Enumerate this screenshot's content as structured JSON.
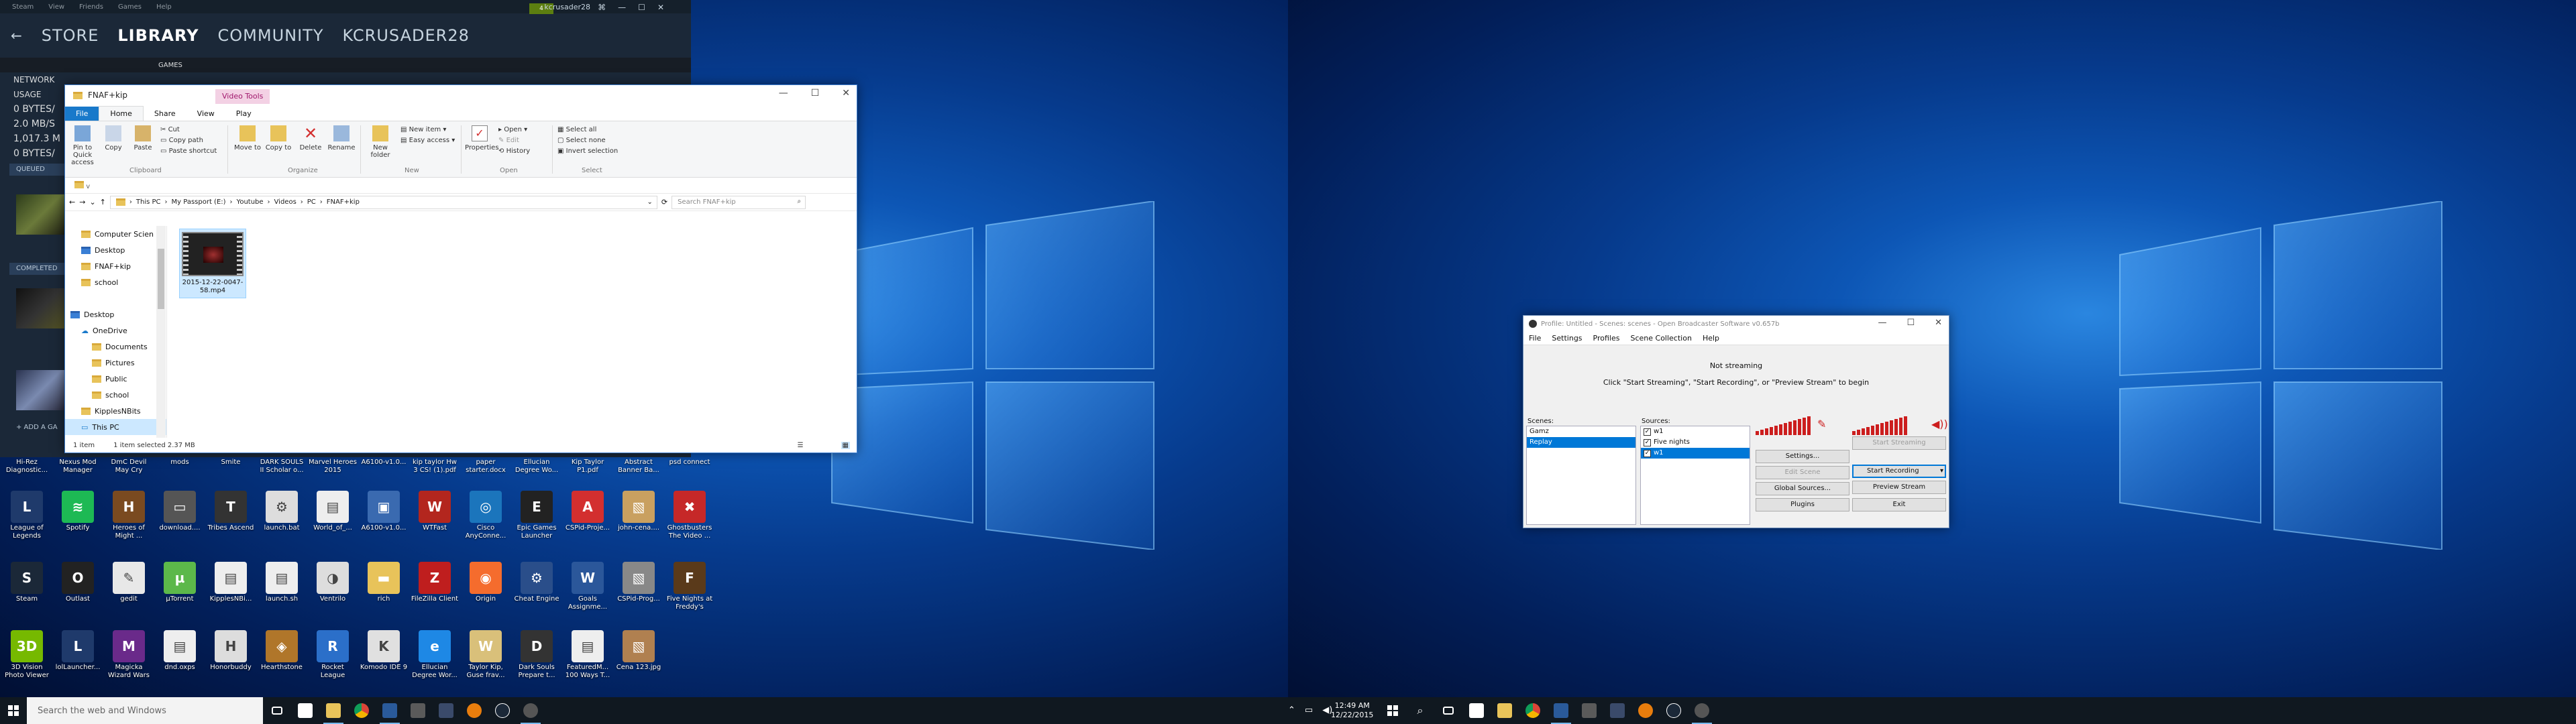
{
  "steam": {
    "menu": [
      "Steam",
      "View",
      "Friends",
      "Games",
      "Help"
    ],
    "nav": [
      "STORE",
      "LIBRARY",
      "COMMUNITY",
      "KCRUSADER28"
    ],
    "active_nav": "LIBRARY",
    "sub_tab": "GAMES",
    "username": "kcrusader28",
    "badge": "4",
    "network_label": "NETWORK USAGE",
    "network_stats": [
      "0 BYTES/",
      "2.0 MB/S",
      "1,017.3 M",
      "0 BYTES/"
    ],
    "queued_label": "QUEUED",
    "completed_label": "COMPLETED",
    "add_game": "+ ADD A GA"
  },
  "explorer": {
    "title": "FNAF+kip",
    "tools_tab": "Video Tools",
    "tabs": [
      "File",
      "Home",
      "Share",
      "View",
      "Play"
    ],
    "ribbon": {
      "pin": "Pin to Quick access",
      "copy": "Copy",
      "paste": "Paste",
      "cut": "Cut",
      "copy_path": "Copy path",
      "paste_shortcut": "Paste shortcut",
      "move_to": "Move to",
      "copy_to": "Copy to",
      "delete": "Delete",
      "rename": "Rename",
      "new_folder": "New folder",
      "new_item": "New item",
      "easy_access": "Easy access",
      "properties": "Properties",
      "open": "Open",
      "edit": "Edit",
      "history": "History",
      "select_all": "Select all",
      "select_none": "Select none",
      "invert_selection": "Invert selection",
      "groups": [
        "Clipboard",
        "Organize",
        "New",
        "Open",
        "Select"
      ]
    },
    "quick_access_bar": "v",
    "path": [
      "This PC",
      "My Passport (E:)",
      "Youtube",
      "Videos",
      "PC",
      "FNAF+kip"
    ],
    "search_placeholder": "Search FNAF+kip",
    "nav_items": [
      {
        "label": "Computer Scien",
        "indent": 1,
        "type": "folder"
      },
      {
        "label": "Desktop",
        "indent": 1,
        "type": "folder-blue"
      },
      {
        "label": "FNAF+kip",
        "indent": 1,
        "type": "folder"
      },
      {
        "label": "school",
        "indent": 1,
        "type": "folder"
      },
      {
        "label": "",
        "indent": 0,
        "type": "spacer"
      },
      {
        "label": "Desktop",
        "indent": 0,
        "type": "folder-blue"
      },
      {
        "label": "OneDrive",
        "indent": 1,
        "type": "cloud"
      },
      {
        "label": "Documents",
        "indent": 2,
        "type": "folder"
      },
      {
        "label": "Pictures",
        "indent": 2,
        "type": "folder"
      },
      {
        "label": "Public",
        "indent": 2,
        "type": "folder"
      },
      {
        "label": "school",
        "indent": 2,
        "type": "folder"
      },
      {
        "label": "KipplesNBits",
        "indent": 1,
        "type": "folder"
      },
      {
        "label": "This PC",
        "indent": 1,
        "type": "pc",
        "selected": true
      },
      {
        "label": "Libraries",
        "indent": 1,
        "type": "folder"
      }
    ],
    "file": {
      "name": "2015-12-22-0047-58.mp4"
    },
    "status": [
      "1 item",
      "1 item selected  2.37 MB"
    ]
  },
  "obs": {
    "title": "Profile: Untitled - Scenes: scenes - Open Broadcaster Software v0.657b",
    "menu": [
      "File",
      "Settings",
      "Profiles",
      "Scene Collection",
      "Help"
    ],
    "status": "Not streaming",
    "hint": "Click \"Start Streaming\", \"Start Recording\", or \"Preview Stream\" to begin",
    "scenes_label": "Scenes:",
    "scenes": [
      {
        "name": "Gamz",
        "selected": false
      },
      {
        "name": "Replay",
        "selected": true
      }
    ],
    "sources_label": "Sources:",
    "sources": [
      {
        "name": "w1",
        "selected": false
      },
      {
        "name": "Five nights",
        "selected": false
      },
      {
        "name": "w1",
        "selected": true
      }
    ],
    "buttons": {
      "start_streaming": "Start Streaming",
      "settings": "Settings...",
      "start_recording": "Start Recording",
      "edit_scene": "Edit Scene",
      "preview_stream": "Preview Stream",
      "global_sources": "Global Sources...",
      "exit": "Exit",
      "plugins": "Plugins"
    }
  },
  "desktop": {
    "top_labels": [
      {
        "label": "Hi-Rez Diagnostic..."
      },
      {
        "label": "Nexus Mod Manager"
      },
      {
        "label": "DmC Devil May Cry"
      },
      {
        "label": "mods"
      },
      {
        "label": "Smite"
      },
      {
        "label": "DARK SOULS II Scholar o..."
      },
      {
        "label": "Marvel Heroes 2015"
      },
      {
        "label": "A6100-v1.0..."
      },
      {
        "label": "kip taylor Hw 3 CS! (1).pdf"
      },
      {
        "label": "paper starter.docx"
      },
      {
        "label": "Ellucian Degree Wo..."
      },
      {
        "label": "Kip Taylor P1.pdf"
      },
      {
        "label": "Abstract Banner Ba..."
      },
      {
        "label": "psd connect"
      }
    ],
    "rows": [
      [
        {
          "label": "League of Legends",
          "icon": "league-icon",
          "color": "#1f3a6b",
          "glyph": "L"
        },
        {
          "label": "Spotify",
          "icon": "spotify-icon",
          "color": "#1db954",
          "glyph": "≋"
        },
        {
          "label": "Heroes of Might ...",
          "icon": "heroes-icon",
          "color": "#7a4a20",
          "glyph": "H"
        },
        {
          "label": "download....",
          "icon": "download-icon",
          "color": "#555",
          "glyph": "▭"
        },
        {
          "label": "Tribes Ascend",
          "icon": "tribes-icon",
          "color": "#333",
          "glyph": "T"
        },
        {
          "label": "launch.bat",
          "icon": "bat-file-icon",
          "color": "#ddd",
          "glyph": "⚙"
        },
        {
          "label": "World_of_...",
          "icon": "file-icon",
          "color": "#eee",
          "glyph": "▤"
        },
        {
          "label": "A6100-v1.0...",
          "icon": "installer-icon",
          "color": "#3a6ab0",
          "glyph": "▣"
        },
        {
          "label": "WTFast",
          "icon": "wtfast-icon",
          "color": "#b3261e",
          "glyph": "W"
        },
        {
          "label": "Cisco AnyConne...",
          "icon": "cisco-icon",
          "color": "#1b75bc",
          "glyph": "◎"
        },
        {
          "label": "Epic Games Launcher",
          "icon": "epic-icon",
          "color": "#222",
          "glyph": "E"
        },
        {
          "label": "CSPid-Proje...",
          "icon": "pdf-icon",
          "color": "#d32f2f",
          "glyph": "A"
        },
        {
          "label": "john-cena....",
          "icon": "image-icon",
          "color": "#c9a060",
          "glyph": "▧"
        },
        {
          "label": "Ghostbusters The Video ...",
          "icon": "ghostbusters-icon",
          "color": "#c62828",
          "glyph": "✖"
        }
      ],
      [
        {
          "label": "Steam",
          "icon": "steam-icon",
          "color": "#1b2838",
          "glyph": "S"
        },
        {
          "label": "Outlast",
          "icon": "outlast-icon",
          "color": "#222",
          "glyph": "O"
        },
        {
          "label": "gedit",
          "icon": "gedit-icon",
          "color": "#e8e8e8",
          "glyph": "✎"
        },
        {
          "label": "µTorrent",
          "icon": "utorrent-icon",
          "color": "#5cb84a",
          "glyph": "µ"
        },
        {
          "label": "KipplesNBi...",
          "icon": "file-icon",
          "color": "#eee",
          "glyph": "▤"
        },
        {
          "label": "launch.sh",
          "icon": "file-icon",
          "color": "#eee",
          "glyph": "▤"
        },
        {
          "label": "Ventrilo",
          "icon": "ventrilo-icon",
          "color": "#ddd",
          "glyph": "◑"
        },
        {
          "label": "rich",
          "icon": "folder-icon",
          "color": "#e8c35a",
          "glyph": "▬"
        },
        {
          "label": "FileZilla Client",
          "icon": "filezilla-icon",
          "color": "#bf1e1e",
          "glyph": "Z"
        },
        {
          "label": "Origin",
          "icon": "origin-icon",
          "color": "#f56c2d",
          "glyph": "◉"
        },
        {
          "label": "Cheat Engine",
          "icon": "cheat-engine-icon",
          "color": "#2a4e8a",
          "glyph": "⚙"
        },
        {
          "label": "Goals Assignme...",
          "icon": "word-doc-icon",
          "color": "#2b579a",
          "glyph": "W"
        },
        {
          "label": "CSPid-Prog...",
          "icon": "image-icon",
          "color": "#888",
          "glyph": "▧"
        },
        {
          "label": "Five Nights at Freddy's",
          "icon": "fnaf-icon",
          "color": "#5a3a1a",
          "glyph": "F"
        }
      ],
      [
        {
          "label": "3D Vision Photo Viewer",
          "icon": "3d-vision-icon",
          "color": "#76b900",
          "glyph": "3D"
        },
        {
          "label": "lolLauncher...",
          "icon": "lol-launcher-icon",
          "color": "#1f3a6b",
          "glyph": "L"
        },
        {
          "label": "Magicka Wizard Wars",
          "icon": "magicka-icon",
          "color": "#6a2a8a",
          "glyph": "M"
        },
        {
          "label": "dnd.oxps",
          "icon": "file-icon",
          "color": "#eee",
          "glyph": "▤"
        },
        {
          "label": "Honorbuddy",
          "icon": "honorbuddy-icon",
          "color": "#ddd",
          "glyph": "H"
        },
        {
          "label": "Hearthstone",
          "icon": "hearthstone-icon",
          "color": "#b0762a",
          "glyph": "◈"
        },
        {
          "label": "Rocket League",
          "icon": "rocket-league-icon",
          "color": "#2b6fc9",
          "glyph": "R"
        },
        {
          "label": "Komodo IDE 9",
          "icon": "komodo-icon",
          "color": "#e0e0e0",
          "glyph": "K"
        },
        {
          "label": "Ellucian Degree Wor...",
          "icon": "ie-shortcut-icon",
          "color": "#1e88e5",
          "glyph": "e"
        },
        {
          "label": "Taylor Kip, Guse frav...",
          "icon": "word-doc-icon",
          "color": "#d9c07a",
          "glyph": "W"
        },
        {
          "label": "Dark Souls Prepare t...",
          "icon": "dark-souls-icon",
          "color": "#333",
          "glyph": "D"
        },
        {
          "label": "FeaturedM... 100 Ways T...",
          "icon": "file-icon",
          "color": "#eee",
          "glyph": "▤"
        },
        {
          "label": "Cena 123.jpg",
          "icon": "image-icon",
          "color": "#b08050",
          "glyph": "▧"
        }
      ]
    ]
  },
  "taskbar": {
    "search_placeholder": "Search the web and Windows",
    "time": "12:49 AM",
    "date": "12/22/2015"
  }
}
